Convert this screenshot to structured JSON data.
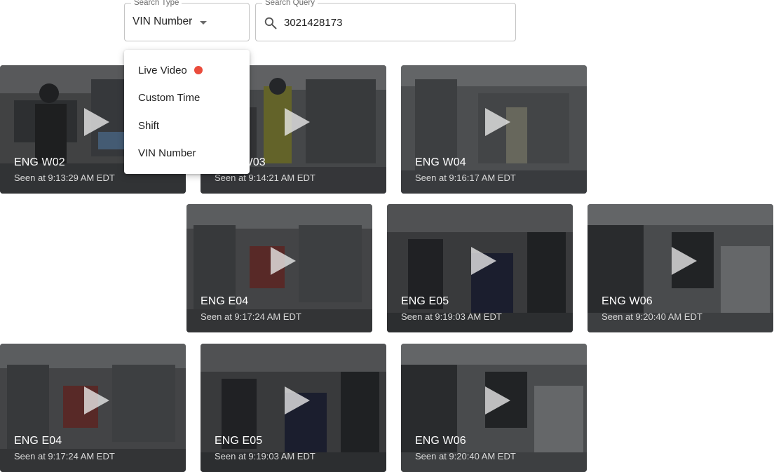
{
  "search_type": {
    "legend": "Search Type",
    "value": "VIN Number",
    "menu": [
      {
        "label": "Live Video",
        "live": true
      },
      {
        "label": "Custom Time"
      },
      {
        "label": "Shift"
      },
      {
        "label": "VIN Number"
      }
    ]
  },
  "search_query": {
    "legend": "Search Query",
    "value": "3021428173"
  },
  "colors": {
    "live_indicator": "#ea4c3c",
    "caption_primary": "#ffffff",
    "caption_secondary": "#d8d8d8"
  },
  "results": [
    {
      "camera": "ENG W02",
      "seen": "Seen at 9:13:29 AM EDT"
    },
    {
      "camera": "ENG W03",
      "seen": "Seen at 9:14:21 AM EDT"
    },
    {
      "camera": "ENG W04",
      "seen": "Seen at 9:16:17 AM EDT"
    },
    {
      "camera": "ENG E04",
      "seen": "Seen at 9:17:24 AM EDT"
    },
    {
      "camera": "ENG E05",
      "seen": "Seen at 9:19:03 AM EDT"
    },
    {
      "camera": "ENG W06",
      "seen": "Seen at 9:20:40 AM EDT"
    },
    {
      "camera": "ENG E04",
      "seen": "Seen at 9:17:24 AM EDT"
    },
    {
      "camera": "ENG E05",
      "seen": "Seen at 9:19:03 AM EDT"
    },
    {
      "camera": "ENG W06",
      "seen": "Seen at 9:20:40 AM EDT"
    }
  ]
}
